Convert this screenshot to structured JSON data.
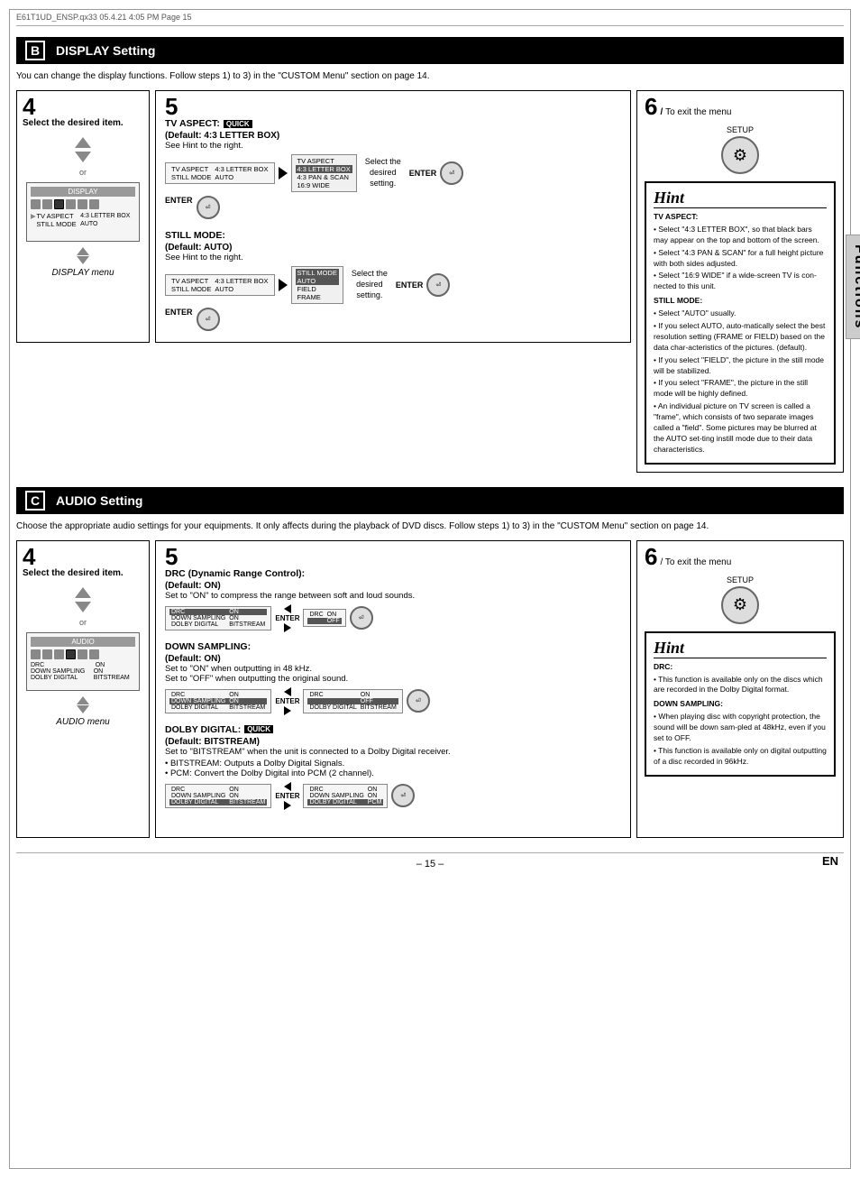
{
  "pageHeader": "E61T1UD_ENSP.qx33   05.4.21 4:05 PM   Page 15",
  "sectionB": {
    "letter": "B",
    "title": "DISPLAY Setting",
    "description": "You can change the display functions. Follow steps 1) to 3) in the \"CUSTOM Menu\" section on page 14."
  },
  "sectionC": {
    "letter": "C",
    "title": "AUDIO Setting",
    "description": "Choose the appropriate audio settings for your equipments. It only affects during the playback of DVD discs. Follow steps 1) to 3) in the \"CUSTOM Menu\" section on page 14."
  },
  "step4Label": "Select the desired item.",
  "step6Label": "To exit the menu",
  "setupLabel": "SETUP",
  "hintLabel": "Hint",
  "displayMenu": {
    "title": "DISPLAY menu",
    "menuTitle": "DISPLAY",
    "rows": [
      {
        "label": "TV ASPECT",
        "value": "4:3 LETTER BOX"
      },
      {
        "label": "STILL MODE",
        "value": "AUTO"
      }
    ]
  },
  "audioMenu": {
    "title": "AUDIO menu",
    "menuTitle": "AUDIO",
    "rows": [
      {
        "label": "DRC",
        "value": "ON"
      },
      {
        "label": "DOWN SAMPLING",
        "value": "ON"
      },
      {
        "label": "DOLBY DIGITAL",
        "value": "BITSTREAM"
      }
    ]
  },
  "displayStep5": {
    "tvAspect": {
      "label": "TV ASPECT:",
      "quickBadge": "QUICK",
      "default": "(Default: 4:3 LETTER BOX)",
      "hint": "See Hint to the right.",
      "menuRows": [
        {
          "col1": "TV ASPECT",
          "col2": "4:3 LETTER BOX"
        },
        {
          "col1": "STILL MODE",
          "col2": "AUTO"
        }
      ],
      "options": [
        {
          "text": "TV ASPECT",
          "highlight": false
        },
        {
          "text": "4:3 LETTER BOX",
          "highlight": true
        },
        {
          "text": "4:3 PAN & SCAN",
          "highlight": false
        },
        {
          "text": "16:9 WIDE",
          "highlight": false
        }
      ]
    },
    "stillMode": {
      "label": "STILL MODE:",
      "default": "(Default: AUTO)",
      "hint": "See Hint to the right.",
      "menuRows": [
        {
          "col1": "TV ASPECT",
          "col2": "4:3 LETTER BOX"
        },
        {
          "col1": "STILL MODE",
          "col2": "AUTO"
        }
      ],
      "options": [
        {
          "text": "STILL MODE",
          "highlight": false
        },
        {
          "text": "AUTO",
          "highlight": true
        },
        {
          "text": "FIELD",
          "highlight": false
        },
        {
          "text": "FRAME",
          "highlight": false
        }
      ]
    }
  },
  "displayHint": {
    "tvAspectHeading": "TV ASPECT:",
    "tvAspectPoints": [
      "Select \"4:3 LETTER BOX\", so that black bars may appear on the top and bottom of the screen.",
      "Select \"4:3 PAN & SCAN\" for a full height picture with both sides adjusted.",
      "Select \"16:9 WIDE\" if a wide-screen TV is connected to this unit."
    ],
    "stillModeHeading": "STILL MODE:",
    "stillModePoints": [
      "Select \"AUTO\" usually.",
      "If you select AUTO, automatically select the best resolution setting (FRAME or FIELD) based on the data characteristics of the pictures. (default).",
      "If you select \"FIELD\", the picture in the still mode will be stabilized.",
      "If you select \"FRAME\", the picture in the still mode will be highly defined.",
      "An individual picture on TV screen is called a \"frame\", which consists of two separate images called a \"field\". Some pictures may be blurred at the AUTO setting instill mode due to their data characteristics."
    ]
  },
  "audioStep5": {
    "drc": {
      "label": "DRC (Dynamic Range Control):",
      "default": "(Default: ON)",
      "desc": "Set to \"ON\" to compress the range between soft and loud sounds.",
      "menu1": {
        "rows": [
          {
            "c1": "DRC",
            "c2": "ON",
            "hl": true
          },
          {
            "c1": "DOWN SAMPLING",
            "c2": "ON",
            "hl": false
          },
          {
            "c1": "DOLBY DIGITAL",
            "c2": "BITSTREAM",
            "hl": false
          }
        ]
      },
      "menu2": {
        "rows": [
          {
            "c1": "DRC",
            "c2": "ON",
            "hl": false
          },
          {
            "c1": "",
            "c2": "OFF",
            "hl": true
          }
        ]
      }
    },
    "downSampling": {
      "label": "DOWN SAMPLING:",
      "default": "(Default: ON)",
      "desc1": "Set to \"ON\" when outputting in 48 kHz.",
      "desc2": "Set to \"OFF\" when outputting the original sound.",
      "menu1": {
        "rows": [
          {
            "c1": "DRC",
            "c2": "ON",
            "hl": false
          },
          {
            "c1": "DOWN SAMPLING",
            "c2": "ON",
            "hl": true
          },
          {
            "c1": "DOLBY DIGITAL",
            "c2": "BITSTREAM",
            "hl": false
          }
        ]
      },
      "menu2": {
        "rows": [
          {
            "c1": "DRC",
            "c2": "ON",
            "hl": false
          },
          {
            "c1": "",
            "c2": "OFF",
            "hl": true
          },
          {
            "c1": "DOLBY DIGITAL",
            "c2": "BITSTREAM",
            "hl": false
          }
        ]
      }
    },
    "dolbyDigital": {
      "label": "DOLBY DIGITAL:",
      "quickBadge": "QUICK",
      "default": "(Default: BITSTREAM)",
      "desc": "Set to \"BITSTREAM\" when the unit is connected to a Dolby Digital receiver.",
      "points": [
        "BITSTREAM: Outputs a Dolby Digital Signals.",
        "PCM: Convert the Dolby Digital into PCM (2 channel)."
      ],
      "menu1": {
        "rows": [
          {
            "c1": "DRC",
            "c2": "ON",
            "hl": false
          },
          {
            "c1": "DOWN SAMPLING",
            "c2": "ON",
            "hl": false
          },
          {
            "c1": "DOLBY DIGITAL",
            "c2": "BITSTREAM",
            "hl": true
          }
        ]
      },
      "menu2": {
        "rows": [
          {
            "c1": "DRC",
            "c2": "ON",
            "hl": false
          },
          {
            "c1": "",
            "c2": "ON",
            "hl": false
          },
          {
            "c1": "DOLBY DIGITAL",
            "c2": "PCM",
            "hl": true
          }
        ]
      }
    }
  },
  "audioHint": {
    "drcHeading": "DRC:",
    "drcPoints": [
      "This function is available only on the discs which are recorded in the Dolby Digital format."
    ],
    "downSamplingHeading": "DOWN SAMPLING:",
    "downSamplingPoints": [
      "When playing disc with copyright protection, the sound will be down sampled at 48kHz, even if you set to OFF.",
      "This function is available only on digital outputting of a disc recorded in 96kHz."
    ]
  },
  "functionsLabel": "Functions",
  "pageNumber": "– 15 –",
  "enLabel": "EN",
  "selectLabel": "Select the desired setting.",
  "enterLabel": "ENTER",
  "orLabel": "or"
}
